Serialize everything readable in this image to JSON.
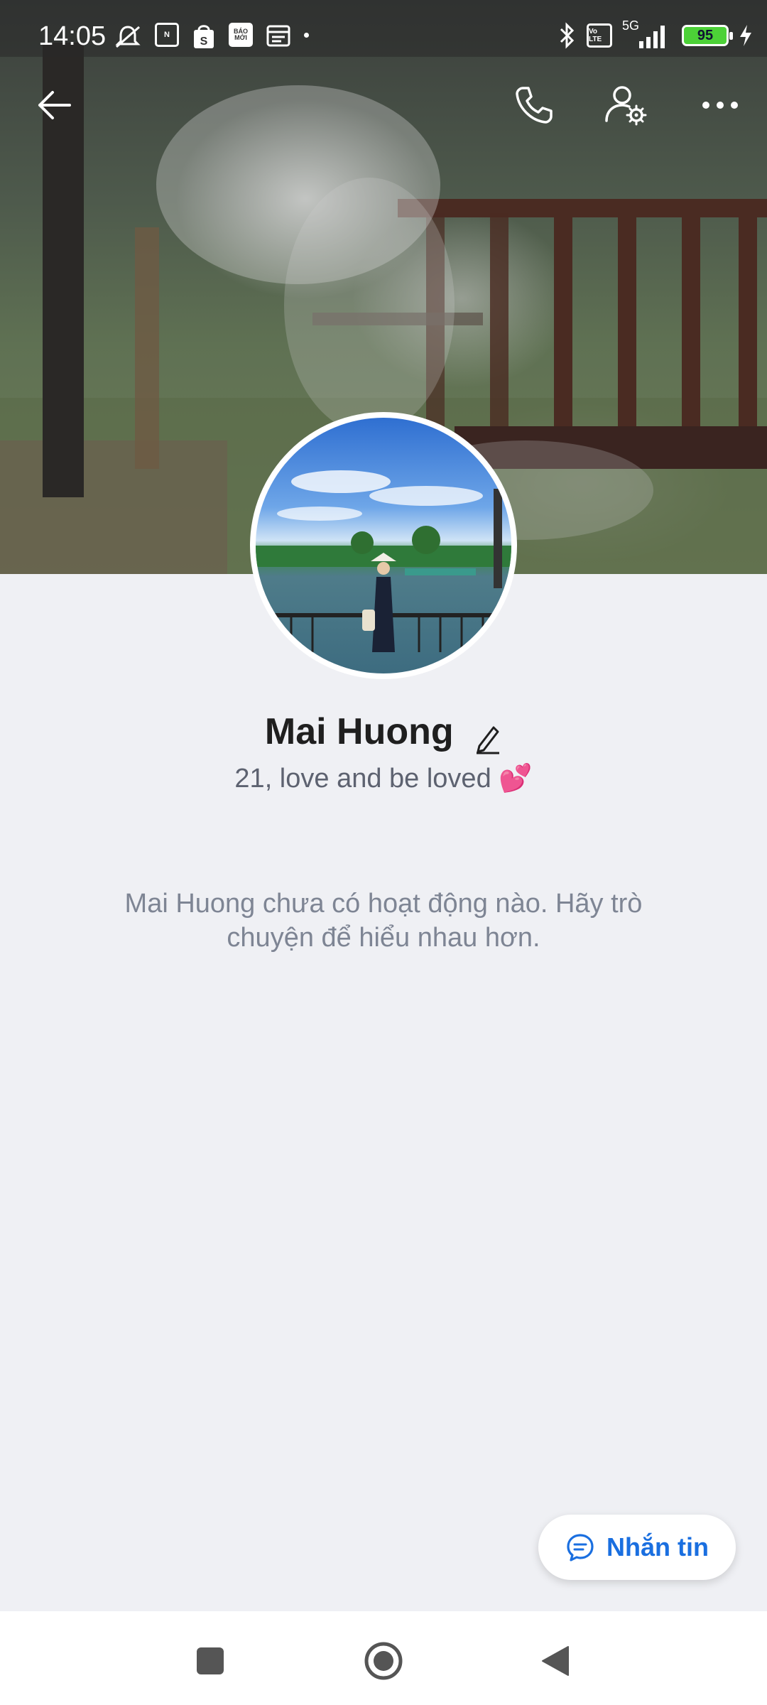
{
  "status_bar": {
    "time": "14:05",
    "left_icons": [
      "mute-bell-icon",
      "nfc-icon",
      "shopee-icon",
      "baomoi-icon",
      "calendar-icon"
    ],
    "baomoi_label": "BÁO MỚI",
    "right_icons": [
      "bluetooth-icon",
      "volte-icon",
      "5g-signal-icon"
    ],
    "network_label": "5G",
    "volte_label": "Vo LTE",
    "battery_level": "95",
    "charging": true
  },
  "header": {
    "back_icon": "arrow-left-icon",
    "call_icon": "phone-icon",
    "settings_icon": "user-settings-icon",
    "more_icon": "more-dots-icon"
  },
  "profile": {
    "name": "Mai Huong",
    "bio": "21, love and be loved 💕",
    "empty_message": "Mai Huong chưa có hoạt động nào. Hãy trò chuyện để hiểu nhau hơn."
  },
  "actions": {
    "message_label": "Nhắn tin"
  },
  "colors": {
    "accent": "#1a6fe0",
    "background": "#eff0f4"
  }
}
